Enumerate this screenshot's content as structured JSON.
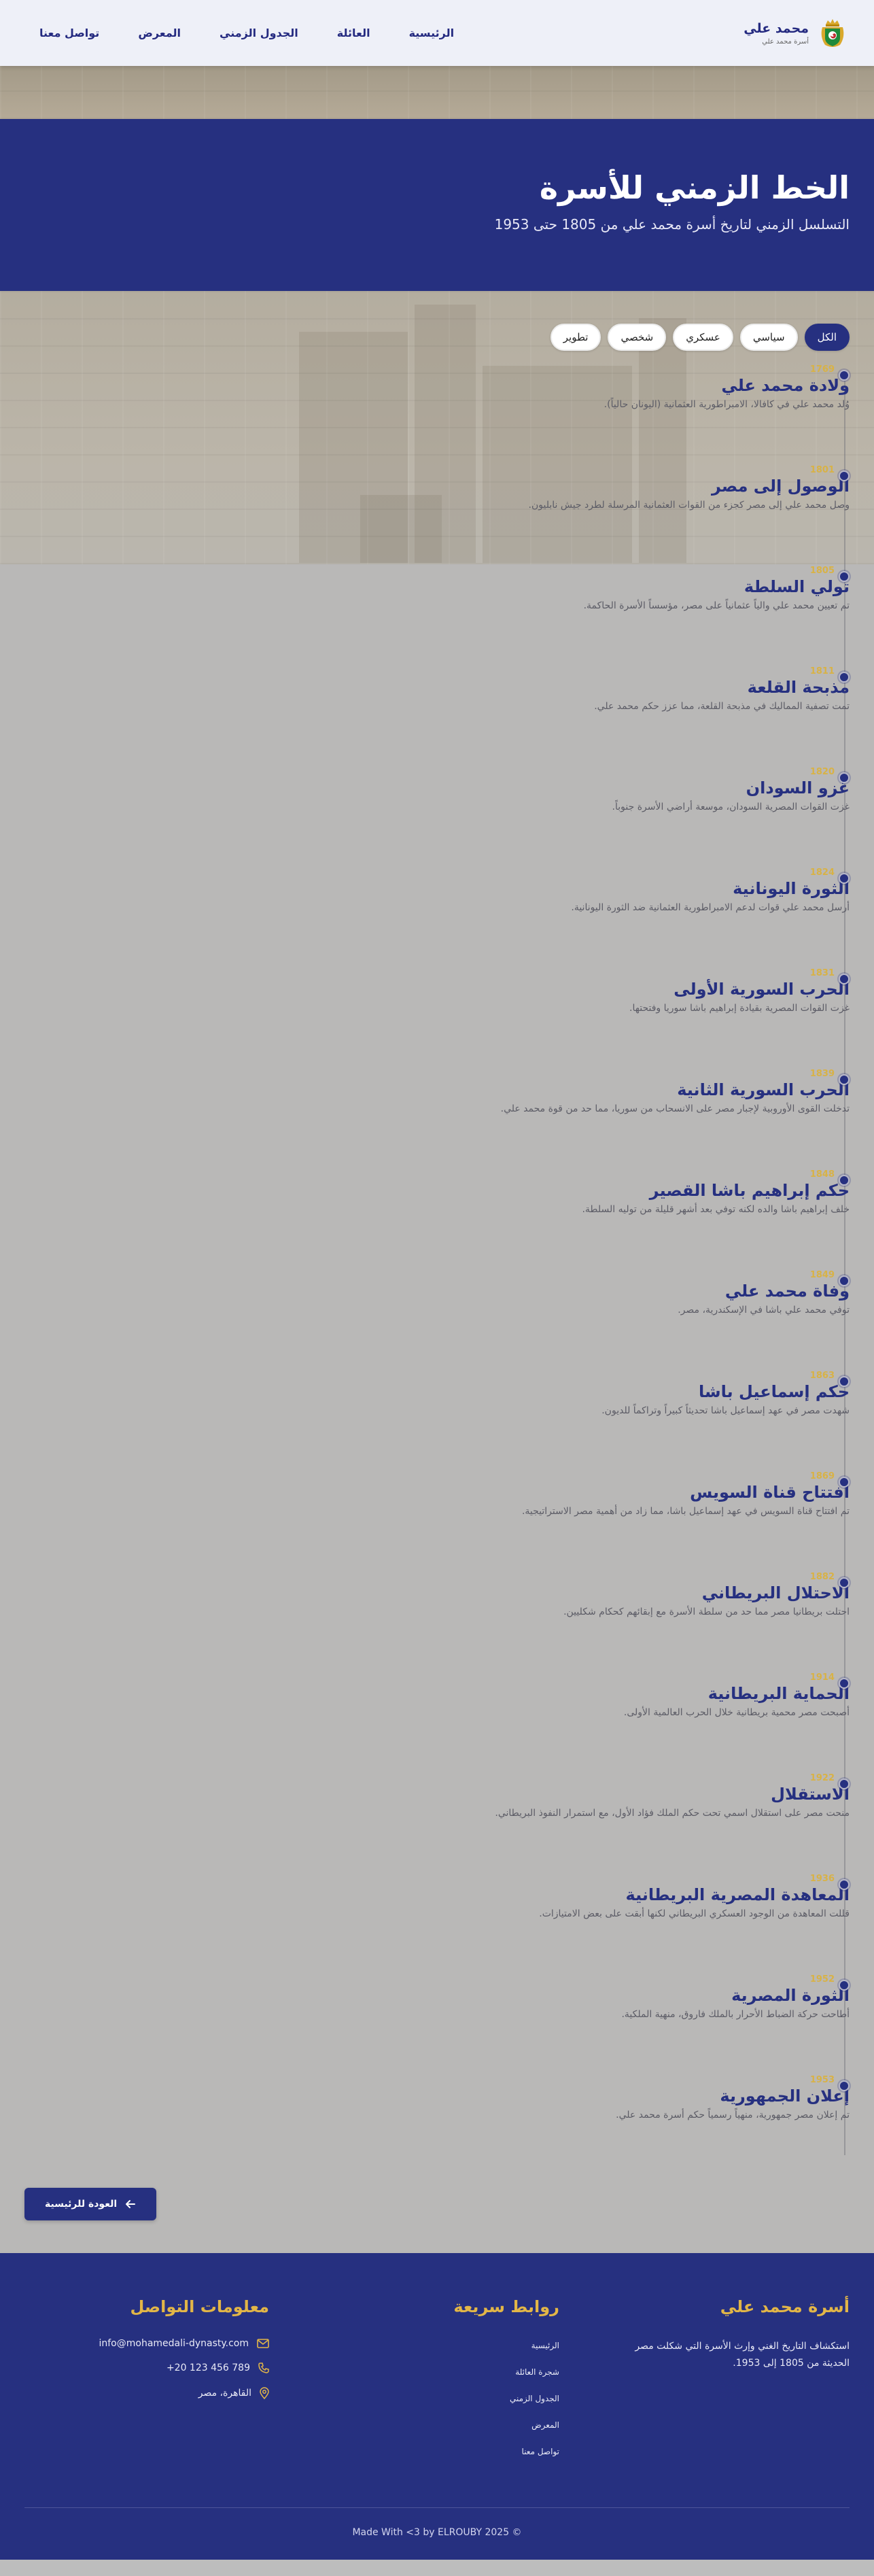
{
  "brand": {
    "name": "محمد علي",
    "subtitle": "أسرة محمد علي"
  },
  "nav": [
    {
      "label": "الرئيسية"
    },
    {
      "label": "العائلة"
    },
    {
      "label": "الجدول الزمني"
    },
    {
      "label": "المعرض"
    },
    {
      "label": "تواصل معنا"
    }
  ],
  "hero": {
    "title": "الخط الزمني للأسرة",
    "subtitle": "التسلسل الزمني لتاريخ أسرة محمد علي من 1805 حتى 1953"
  },
  "filters": [
    {
      "label": "الكل",
      "active": true
    },
    {
      "label": "سياسي",
      "active": false
    },
    {
      "label": "عسكري",
      "active": false
    },
    {
      "label": "شخصي",
      "active": false
    },
    {
      "label": "تطوير",
      "active": false
    }
  ],
  "events": [
    {
      "year": "1769",
      "title": "ولادة محمد علي",
      "desc": "وُلد محمد علي في كافالا، الامبراطورية العثمانية (اليونان حالياً)."
    },
    {
      "year": "1801",
      "title": "الوصول إلى مصر",
      "desc": "وصل محمد علي إلى مصر كجزء من القوات العثمانية المرسلة لطرد جيش نابليون."
    },
    {
      "year": "1805",
      "title": "تولي السلطة",
      "desc": "تم تعيين محمد علي والياً عثمانياً على مصر، مؤسساً الأسرة الحاكمة."
    },
    {
      "year": "1811",
      "title": "مذبحة القلعة",
      "desc": "تمت تصفية المماليك في مذبحة القلعة، مما عزز حكم محمد علي."
    },
    {
      "year": "1820",
      "title": "غزو السودان",
      "desc": "غزت القوات المصرية السودان، موسعة أراضي الأسرة جنوباً."
    },
    {
      "year": "1824",
      "title": "الثورة اليونانية",
      "desc": "أرسل محمد علي قوات لدعم الامبراطورية العثمانية ضد الثورة اليونانية."
    },
    {
      "year": "1831",
      "title": "الحرب السورية الأولى",
      "desc": "غزت القوات المصرية بقيادة إبراهيم باشا سوريا وفتحتها."
    },
    {
      "year": "1839",
      "title": "الحرب السورية الثانية",
      "desc": "تدخلت القوى الأوروبية لإجبار مصر على الانسحاب من سوريا، مما حد من قوة محمد علي."
    },
    {
      "year": "1848",
      "title": "حكم إبراهيم باشا القصير",
      "desc": "خلف إبراهيم باشا والده لكنه توفي بعد أشهر قليلة من توليه السلطة."
    },
    {
      "year": "1849",
      "title": "وفاة محمد علي",
      "desc": "توفي محمد علي باشا في الإسكندرية، مصر."
    },
    {
      "year": "1863",
      "title": "حكم إسماعيل باشا",
      "desc": "شهدت مصر في عهد إسماعيل باشا تحديثاً كبيراً وتراكماً للديون."
    },
    {
      "year": "1869",
      "title": "افتتاح قناة السويس",
      "desc": "تم افتتاح قناة السويس في عهد إسماعيل باشا، مما زاد من أهمية مصر الاستراتيجية."
    },
    {
      "year": "1882",
      "title": "الاحتلال البريطاني",
      "desc": "احتلت بريطانيا مصر مما حد من سلطة الأسرة مع إبقائهم كحكام شكليين."
    },
    {
      "year": "1914",
      "title": "الحماية البريطانية",
      "desc": "أصبحت مصر محمية بريطانية خلال الحرب العالمية الأولى."
    },
    {
      "year": "1922",
      "title": "الاستقلال",
      "desc": "منحت مصر على استقلال اسمي تحت حكم الملك فؤاد الأول، مع استمرار النفوذ البريطاني."
    },
    {
      "year": "1936",
      "title": "المعاهدة المصرية البريطانية",
      "desc": "قللت المعاهدة من الوجود العسكري البريطاني لكنها أبقت على بعض الامتيازات."
    },
    {
      "year": "1952",
      "title": "الثورة المصرية",
      "desc": "أطاحت حركة الضباط الأحرار بالملك فاروق، منهية الملكية."
    },
    {
      "year": "1953",
      "title": "إعلان الجمهورية",
      "desc": "تم إعلان مصر جمهورية، منهياً رسمياً حكم أسرة محمد علي."
    }
  ],
  "back_button": {
    "label": "العودة للرئيسية"
  },
  "footer": {
    "about_title": "أسرة محمد علي",
    "about_text": "استكشاف التاريخ الغني وإرث الأسرة التي شكلت مصر الحديثة من 1805 إلى 1953.",
    "links_title": "روابط سريعة",
    "links": [
      {
        "label": "الرئيسية"
      },
      {
        "label": "شجرة العائلة"
      },
      {
        "label": "الجدول الزمني"
      },
      {
        "label": "المعرض"
      },
      {
        "label": "تواصل معنا"
      }
    ],
    "contact_title": "معلومات التواصل",
    "contact": {
      "email": "info@mohamedali-dynasty.com",
      "phone": "+20 123 456 789",
      "address": "القاهرة، مصر"
    },
    "copyright": "Made With <3 by ELROUBY 2025 ©"
  },
  "colors": {
    "primary": "#263080",
    "gold": "#e2b647",
    "background": "#bdbdbd"
  }
}
